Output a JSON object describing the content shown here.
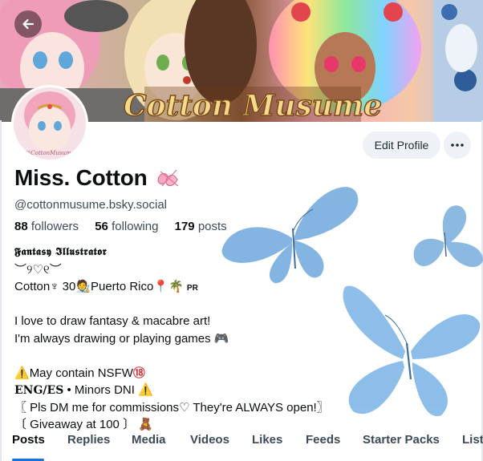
{
  "banner": {
    "text": "Cotton Musume"
  },
  "profile": {
    "display_name": "Miss. Cotton",
    "handle": "@cottonmusume.bsky.social",
    "avatar_caption": "@CottonMusume"
  },
  "actions": {
    "edit_label": "Edit Profile",
    "more_label": "···"
  },
  "stats": {
    "followers_count": "88",
    "followers_label": "followers",
    "following_count": "56",
    "following_label": "following",
    "posts_count": "179",
    "posts_label": "posts"
  },
  "bio": {
    "line1": "𝕱𝖆𝖓𝖙𝖆𝖘𝖞 𝕴𝖑𝖑𝖚𝖘𝖙𝖗𝖆𝖙𝖔𝖗",
    "line2": "︶୨♡୧︶",
    "line3_a": "Cotton♆ 30",
    "line3_b": "Puerto Rico",
    "line3_c": "PR",
    "line4": "",
    "line5": "I love to draw fantasy & macabre art!",
    "line6": "I'm always drawing or playing games 🎮",
    "line7": "",
    "line8_a": "May contain NSFW",
    "line8_b": "⑱",
    "line9_a": "ENG/ES",
    "line9_b": " • Minors DNI ",
    "line10": "〖 Pls DM me for commissions♡ They're ALWAYS open!〗",
    "line11": "〔 Giveaway at 100 〕"
  },
  "tabs": [
    "Posts",
    "Replies",
    "Media",
    "Videos",
    "Likes",
    "Feeds",
    "Starter Packs",
    "List"
  ],
  "colors": {
    "accent": "#1e6fd9",
    "butterfly": "#6fa8dc"
  }
}
